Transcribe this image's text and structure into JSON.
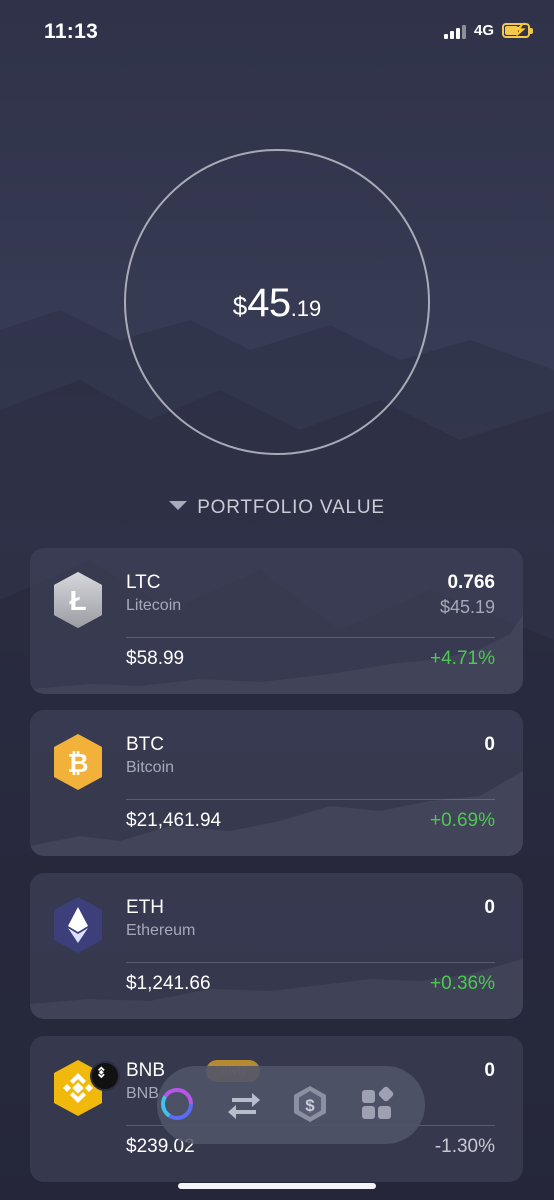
{
  "status_bar": {
    "time": "11:13",
    "network": "4G"
  },
  "portfolio": {
    "currency_symbol": "$",
    "value_integer": "45",
    "value_decimal": ".19",
    "label": "PORTFOLIO VALUE"
  },
  "assets": [
    {
      "symbol": "LTC",
      "name": "Litecoin",
      "amount": "0.766",
      "fiat_value": "$45.19",
      "price": "$58.99",
      "change": "+4.71%",
      "icon": "litecoin-icon"
    },
    {
      "symbol": "BTC",
      "name": "Bitcoin",
      "amount": "0",
      "fiat_value": "",
      "price": "$21,461.94",
      "change": "+0.69%",
      "icon": "bitcoin-icon"
    },
    {
      "symbol": "ETH",
      "name": "Ethereum",
      "amount": "0",
      "fiat_value": "",
      "price": "$1,241.66",
      "change": "+0.36%",
      "icon": "ethereum-icon"
    },
    {
      "symbol": "BNB",
      "name": "BNB",
      "tag": "BNB",
      "amount": "0",
      "fiat_value": "",
      "price": "$239.02",
      "change": "-1.30%",
      "icon": "bnb-icon"
    }
  ],
  "nav": {
    "items": [
      "portfolio-icon",
      "exchange-icon",
      "earn-icon",
      "apps-icon"
    ]
  },
  "colors": {
    "positive": "#4cc850",
    "ltc": "#b8b9bf",
    "btc": "#f2b23a",
    "eth": "#3c3f7a",
    "bnb": "#f0b90b"
  }
}
